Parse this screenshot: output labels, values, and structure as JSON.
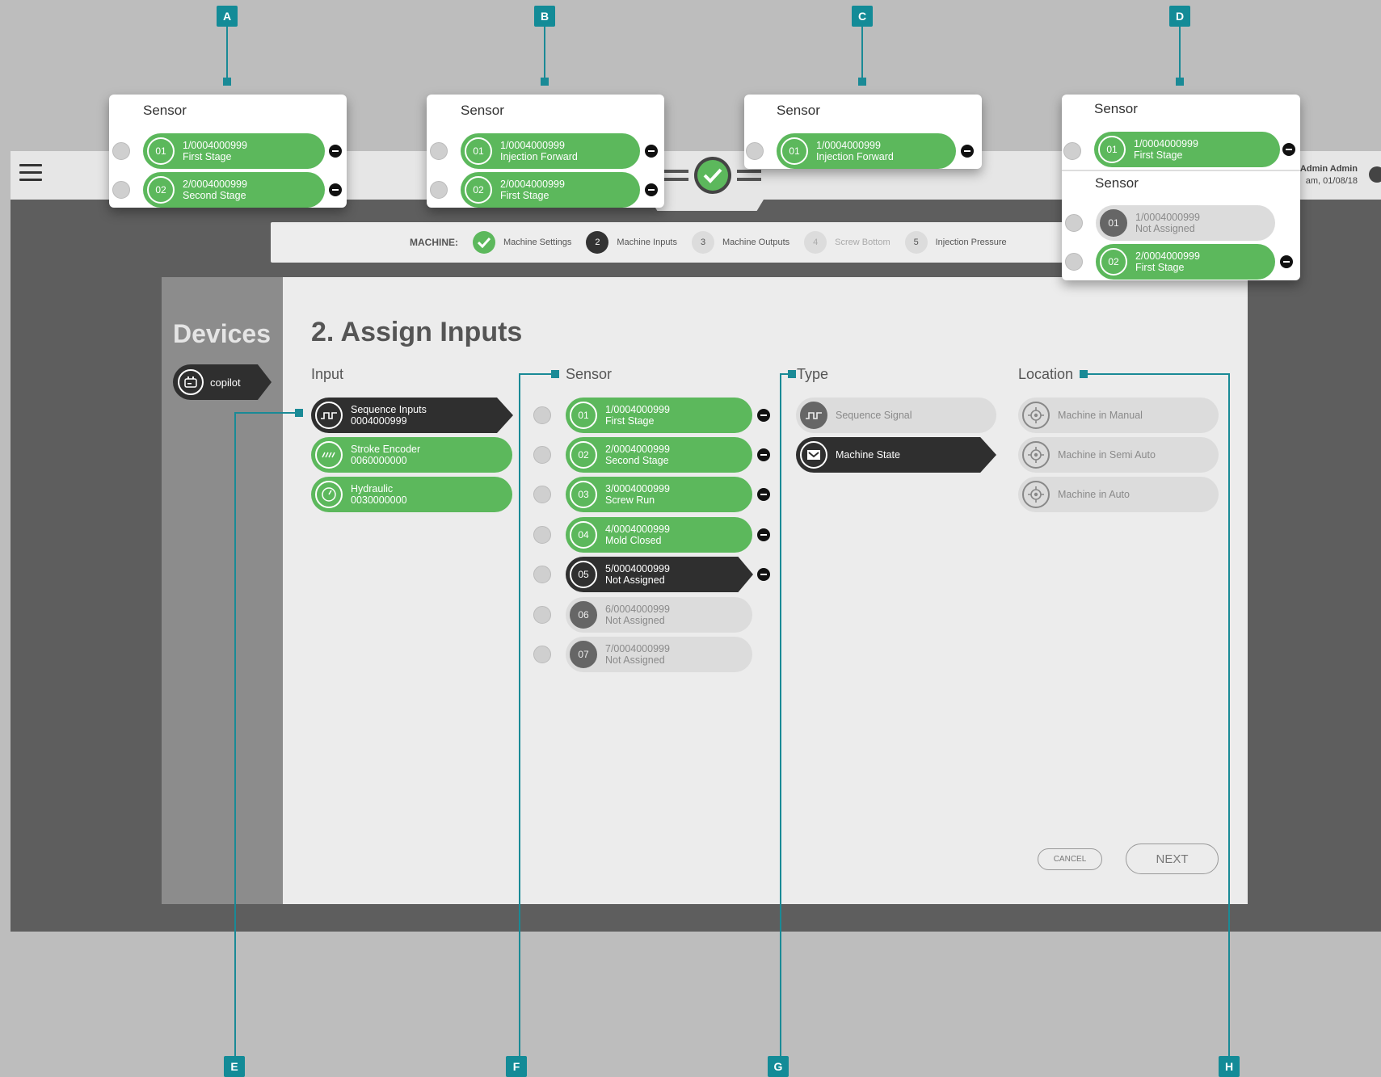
{
  "user": {
    "name": "Admin Admin",
    "datetime": "am, 01/08/18"
  },
  "stepper": {
    "label": "MACHINE:",
    "steps": [
      {
        "num": "",
        "label": "Machine Settings"
      },
      {
        "num": "2",
        "label": "Machine Inputs"
      },
      {
        "num": "3",
        "label": "Machine Outputs"
      },
      {
        "num": "4",
        "label": "Screw Bottom"
      },
      {
        "num": "5",
        "label": "Injection Pressure"
      }
    ]
  },
  "sidebar": {
    "title": "Devices",
    "device": "copilot"
  },
  "main": {
    "title": "2. Assign Inputs",
    "headers": {
      "input": "Input",
      "sensor": "Sensor",
      "type": "Type",
      "location": "Location"
    },
    "inputs": [
      {
        "name": "Sequence Inputs",
        "id": "0004000999",
        "icon": "sequence-icon"
      },
      {
        "name": "Stroke Encoder",
        "id": "0060000000",
        "icon": "encoder-icon"
      },
      {
        "name": "Hydraulic",
        "id": "0030000000",
        "icon": "gauge-icon"
      }
    ],
    "sensors": [
      {
        "num": "01",
        "id": "1/0004000999",
        "label": "First Stage"
      },
      {
        "num": "02",
        "id": "2/0004000999",
        "label": "Second Stage"
      },
      {
        "num": "03",
        "id": "3/0004000999",
        "label": "Screw Run"
      },
      {
        "num": "04",
        "id": "4/0004000999",
        "label": "Mold Closed"
      },
      {
        "num": "05",
        "id": "5/0004000999",
        "label": "Not Assigned"
      },
      {
        "num": "06",
        "id": "6/0004000999",
        "label": "Not Assigned"
      },
      {
        "num": "07",
        "id": "7/0004000999",
        "label": "Not Assigned"
      }
    ],
    "types": [
      "Sequence Signal",
      "Machine State"
    ],
    "locations": [
      "Machine in Manual",
      "Machine in Semi Auto",
      "Machine in Auto"
    ],
    "cancel": "CANCEL",
    "next": "NEXT"
  },
  "popups": {
    "title": "Sensor",
    "A": [
      {
        "num": "01",
        "id": "1/0004000999",
        "label": "First Stage"
      },
      {
        "num": "02",
        "id": "2/0004000999",
        "label": "Second Stage"
      }
    ],
    "B": [
      {
        "num": "01",
        "id": "1/0004000999",
        "label": "Injection Forward"
      },
      {
        "num": "02",
        "id": "2/0004000999",
        "label": "First Stage"
      }
    ],
    "C": [
      {
        "num": "01",
        "id": "1/0004000999",
        "label": "Injection Forward"
      }
    ],
    "D1": [
      {
        "num": "01",
        "id": "1/0004000999",
        "label": "First Stage"
      }
    ],
    "D2": [
      {
        "num": "01",
        "id": "1/0004000999",
        "label": "Not Assigned"
      },
      {
        "num": "02",
        "id": "2/0004000999",
        "label": "First Stage"
      }
    ]
  },
  "callouts": [
    "A",
    "B",
    "C",
    "D",
    "E",
    "F",
    "G",
    "H"
  ],
  "colors": {
    "green": "#5cb85c",
    "dark": "#2f2f2f",
    "teal": "#138b97"
  }
}
